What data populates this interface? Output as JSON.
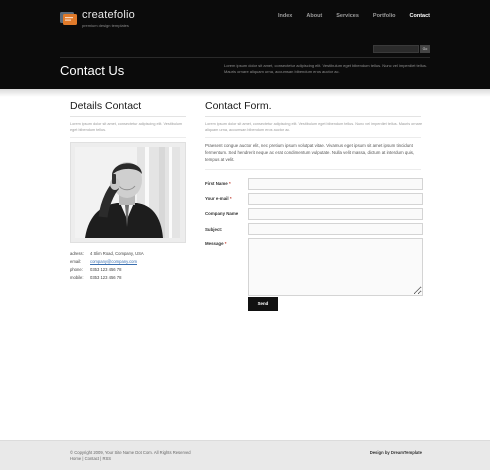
{
  "brand": {
    "name": "createfolio",
    "tagline": "premium design templates"
  },
  "nav": [
    {
      "label": "Index",
      "active": false
    },
    {
      "label": "About",
      "active": false
    },
    {
      "label": "Services",
      "active": false
    },
    {
      "label": "Portfolio",
      "active": false
    },
    {
      "label": "Contact",
      "active": true
    }
  ],
  "search": {
    "placeholder": "",
    "button_label": "Go"
  },
  "header": {
    "title": "Contact Us",
    "text": "Lorem ipsum dolor sit amet, consectetur adipiscing elit. Vestibulum eget bibendum tellus. Nunc vel imperdiet tellus. Mauris ornare aliquam urna, accumsan bibendum eros auctor ac."
  },
  "details": {
    "title": "Details Contact",
    "intro": "Lorem ipsum dolor sit amet, consectetur adipiscing elit. Vestibulum eget bibendum tellus.",
    "address": [
      {
        "key": "adress:",
        "value": "4 Slim Road, Company, USA",
        "link": false
      },
      {
        "key": "email:",
        "value": "company@company.com",
        "link": true
      },
      {
        "key": "phone:",
        "value": "0353 123 456 78",
        "link": false
      },
      {
        "key": "mobile:",
        "value": "0353 123 456 78",
        "link": false
      }
    ]
  },
  "form": {
    "title": "Contact Form.",
    "intro": "Lorem ipsum dolor sit amet, consectetur adipiscing elit. Vestibulum eget bibendum tellus. Nunc vel imperdiet tellus. Mauris ornare aliquam urna, accumsan bibendum eros auctor ac.",
    "paragraph": "Praesent congue auctor elit, nec pretium ipsum volutpat vitae. Vivamus eget ipsum sit amet ipsum tincidunt fermentum. Sed hendrerit neque ac erat condimentum vulputate. Nulla velit massa, dictum at interdum quis, tempus at velit.",
    "fields": [
      {
        "label": "First Name",
        "required": true,
        "type": "input"
      },
      {
        "label": "Your e-mail",
        "required": true,
        "type": "input"
      },
      {
        "label": "Company Name",
        "required": false,
        "type": "input"
      },
      {
        "label": "Subject:",
        "required": false,
        "type": "input"
      },
      {
        "label": "Message",
        "required": true,
        "type": "textarea"
      }
    ],
    "submit_label": "Send"
  },
  "footer": {
    "copyright": "© Copyright 2009, Your Site Name Dot Com. All Rights Reserved",
    "links": [
      "Home",
      "Contact",
      "RSS"
    ],
    "credit": "Design by DreamTemplate"
  },
  "colors": {
    "header_bg": "#0b0b0b",
    "accent_orange": "#e07a2a",
    "required": "#c0392b",
    "link": "#3a6fb0"
  }
}
